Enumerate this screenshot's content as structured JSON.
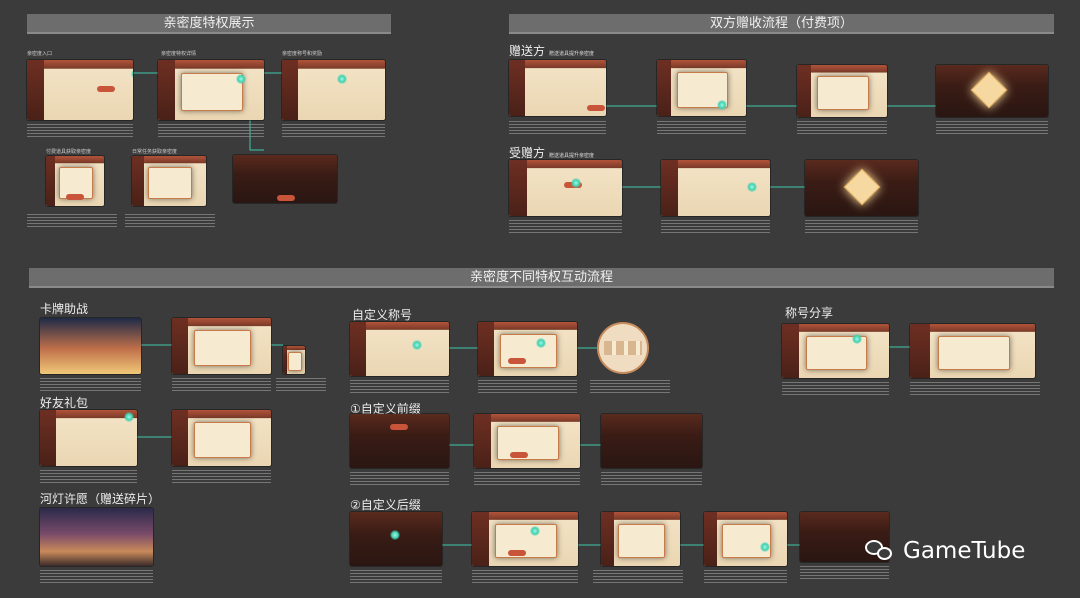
{
  "sections": {
    "intimacy_privileges": "亲密度特权展示",
    "gift_flow": "双方赠收流程（付费项）",
    "interaction_flow": "亲密度不同特权互动流程"
  },
  "labels": {
    "entry": "亲密度入口",
    "privilege_details": "亲密度特权详情",
    "title_reward": "亲密度称号和奖励",
    "paid_items": "付费道具获取亲密度",
    "daily_tasks": "日常任务获取亲密度",
    "sender": "赠送方",
    "sender_sub": "赠送道具提升亲密度",
    "receiver": "受赠方",
    "receiver_sub": "赠送道具提升亲密度",
    "card_battle": "卡牌助战",
    "friend_gift": "好友礼包",
    "lantern_wish": "河灯许愿（赠送碎片）",
    "custom_title": "自定义称号",
    "custom_prefix": "①自定义前缀",
    "custom_suffix": "②自定义后缀",
    "title_share": "称号分享"
  },
  "logo": {
    "text": "GameTube",
    "icon": "wechat-bubble-icon"
  }
}
